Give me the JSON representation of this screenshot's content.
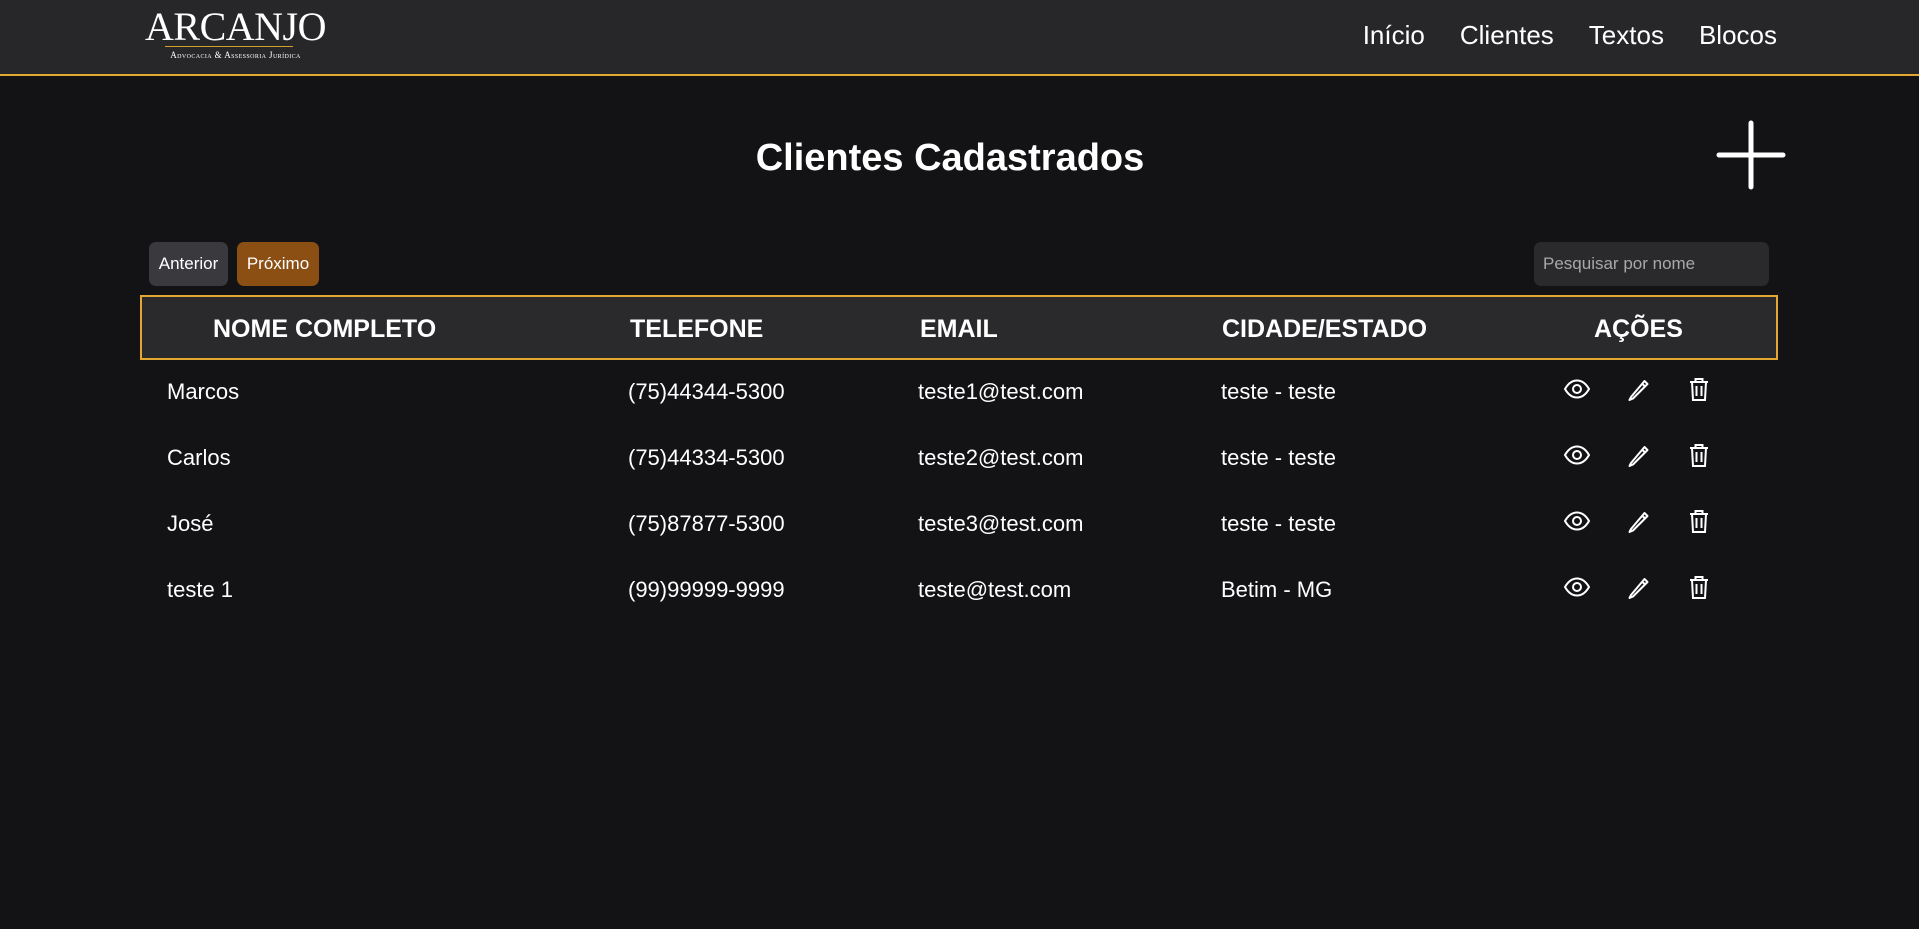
{
  "header": {
    "logo_title": "ARCANJO",
    "logo_subtitle": "Advocacia & Assessoria Jurídica",
    "nav": [
      "Início",
      "Clientes",
      "Textos",
      "Blocos"
    ]
  },
  "page_title": "Clientes Cadastrados",
  "add_icon": "plus-icon",
  "pagination": {
    "prev_label": "Anterior",
    "next_label": "Próximo"
  },
  "search": {
    "placeholder": "Pesquisar por nome",
    "value": ""
  },
  "table": {
    "headers": [
      "NOME COMPLETO",
      "TELEFONE",
      "EMAIL",
      "CIDADE/ESTADO",
      "AÇÕES"
    ],
    "rows": [
      {
        "name": "Marcos",
        "phone": "(75)44344-5300",
        "email": "teste1@test.com",
        "city": "teste - teste"
      },
      {
        "name": "Carlos",
        "phone": "(75)44334-5300",
        "email": "teste2@test.com",
        "city": "teste - teste"
      },
      {
        "name": "José",
        "phone": "(75)87877-5300",
        "email": "teste3@test.com",
        "city": "teste - teste"
      },
      {
        "name": "teste 1",
        "phone": "(99)99999-9999",
        "email": "teste@test.com",
        "city": "Betim - MG"
      }
    ],
    "action_icons": [
      "eye-icon",
      "pencil-icon",
      "trash-icon"
    ]
  },
  "colors": {
    "background": "#131315",
    "header_bg": "#27272a",
    "accent": "#e3a62f",
    "next_button": "#8b4f13",
    "prev_button": "#3a3a3e"
  }
}
